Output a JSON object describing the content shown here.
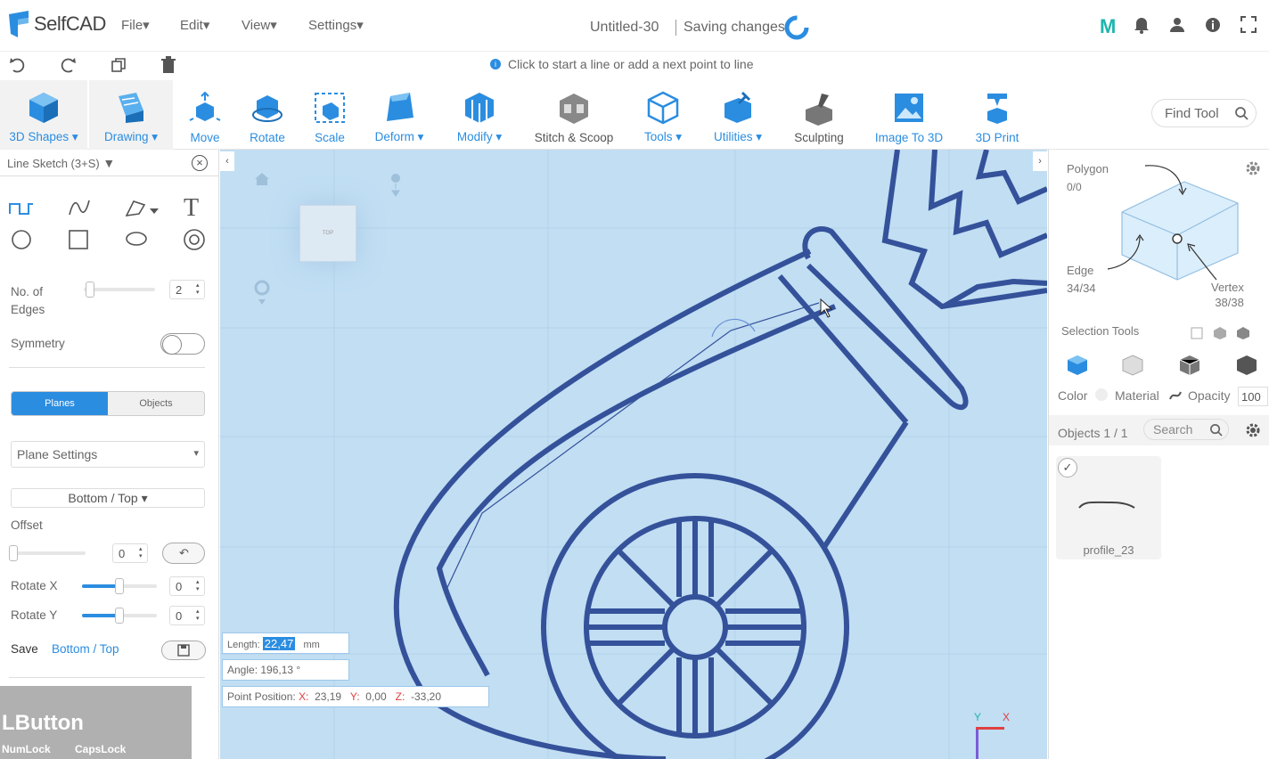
{
  "app": {
    "name": "SelfCAD",
    "menus": [
      "File",
      "Edit",
      "View",
      "Settings"
    ],
    "doc_title": "Untitled-30",
    "status": "Saving changes",
    "user_initial": "M",
    "brand_color": "#2b8de0"
  },
  "hint": "Click to start a line or add a next point to line",
  "toolbar": {
    "tools": [
      "3D Shapes",
      "Drawing",
      "Move",
      "Rotate",
      "Scale",
      "Deform",
      "Modify",
      "Stitch & Scoop",
      "Tools",
      "Utilities",
      "Sculpting",
      "Image To 3D",
      "3D Print"
    ],
    "find_tool": "Find Tool"
  },
  "left": {
    "title": "Line Sketch (3+S)",
    "edges_label": [
      "No. of",
      "Edges"
    ],
    "edges_value": "2",
    "symmetry": "Symmetry",
    "tabs": {
      "planes": "Planes",
      "objects": "Objects"
    },
    "plane_settings": "Plane Settings",
    "plane_choice": "Bottom / Top",
    "offset_label": "Offset",
    "offset_value": "0",
    "rotx_label": "Rotate X",
    "rotx_value": "0",
    "rotx_fraction": 0.5,
    "roty_label": "Rotate Y",
    "roty_value": "0",
    "roty_fraction": 0.5,
    "save_label": "Save",
    "save_plane": "Bottom / Top",
    "overlay": {
      "lbutton": "LButton",
      "numlock": "NumLock",
      "capslock": "CapsLock"
    }
  },
  "viewport": {
    "navcube_label": "TOP",
    "length_label": "Length:",
    "length_value": "22,47",
    "length_unit": "mm",
    "angle_label": "Angle:",
    "angle_value": "196,13",
    "angle_unit": "°",
    "pos_label": "Point Position:",
    "x_label": "X:",
    "x_value": "23,19",
    "y_label": "Y:",
    "y_value": "0,00",
    "z_label": "Z:",
    "z_value": "-33,20",
    "axis_y": "Y",
    "axis_x": "X"
  },
  "right": {
    "polygon_label": "Polygon",
    "polygon_count": "0/0",
    "edge_label": "Edge",
    "edge_count": "34/34",
    "vertex_label": "Vertex",
    "vertex_count": "38/38",
    "selection_tools": "Selection Tools",
    "color_label": "Color",
    "material_label": "Material",
    "opacity_label": "Opacity",
    "opacity_value": "100",
    "objects_label": "Objects 1 / 1",
    "search_placeholder": "Search",
    "object_name": "profile_23"
  }
}
